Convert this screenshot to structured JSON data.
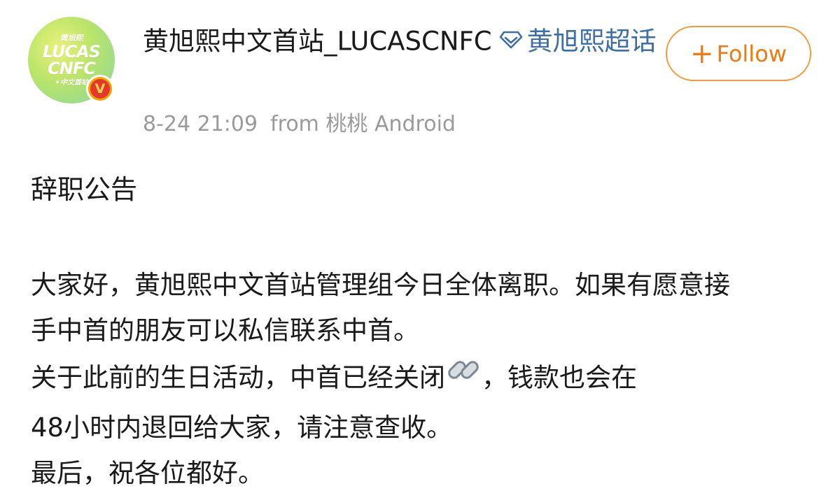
{
  "account": {
    "avatar_text_top": "黄旭熙",
    "avatar_text_line1": "LUCAS",
    "avatar_text_line2": "CNFC",
    "avatar_text_sub": "✦中文首站",
    "verified_mark": "V",
    "username": "黄旭熙中文首站_LUCASCNFC",
    "supertopic": "黄旭熙超话",
    "timestamp": "8-24 21:09",
    "source": "from 桃桃 Android"
  },
  "follow": {
    "plus": "+",
    "label": "Follow"
  },
  "post": {
    "title": "辞职公告",
    "lines": [
      "大家好，黄旭熙中文首站管理组今日全体离职。如果有愿意接",
      "手中首的朋友可以私信联系中首。",
      "关于此前的生日活动，中首已经关闭",
      "，钱款也会在",
      "48小时内退回给大家，请注意查收。",
      "最后，祝各位都好。"
    ]
  },
  "icons": {
    "supertopic": "diamond-icon",
    "link": "link-icon",
    "verified": "verified-badge-icon"
  },
  "colors": {
    "follow_accent": "#f07b0f",
    "supertopic_link": "#3e6ea6",
    "meta_text": "#9a9a9a",
    "verified_gold": "#f2a500",
    "verified_red": "#e4382b"
  }
}
